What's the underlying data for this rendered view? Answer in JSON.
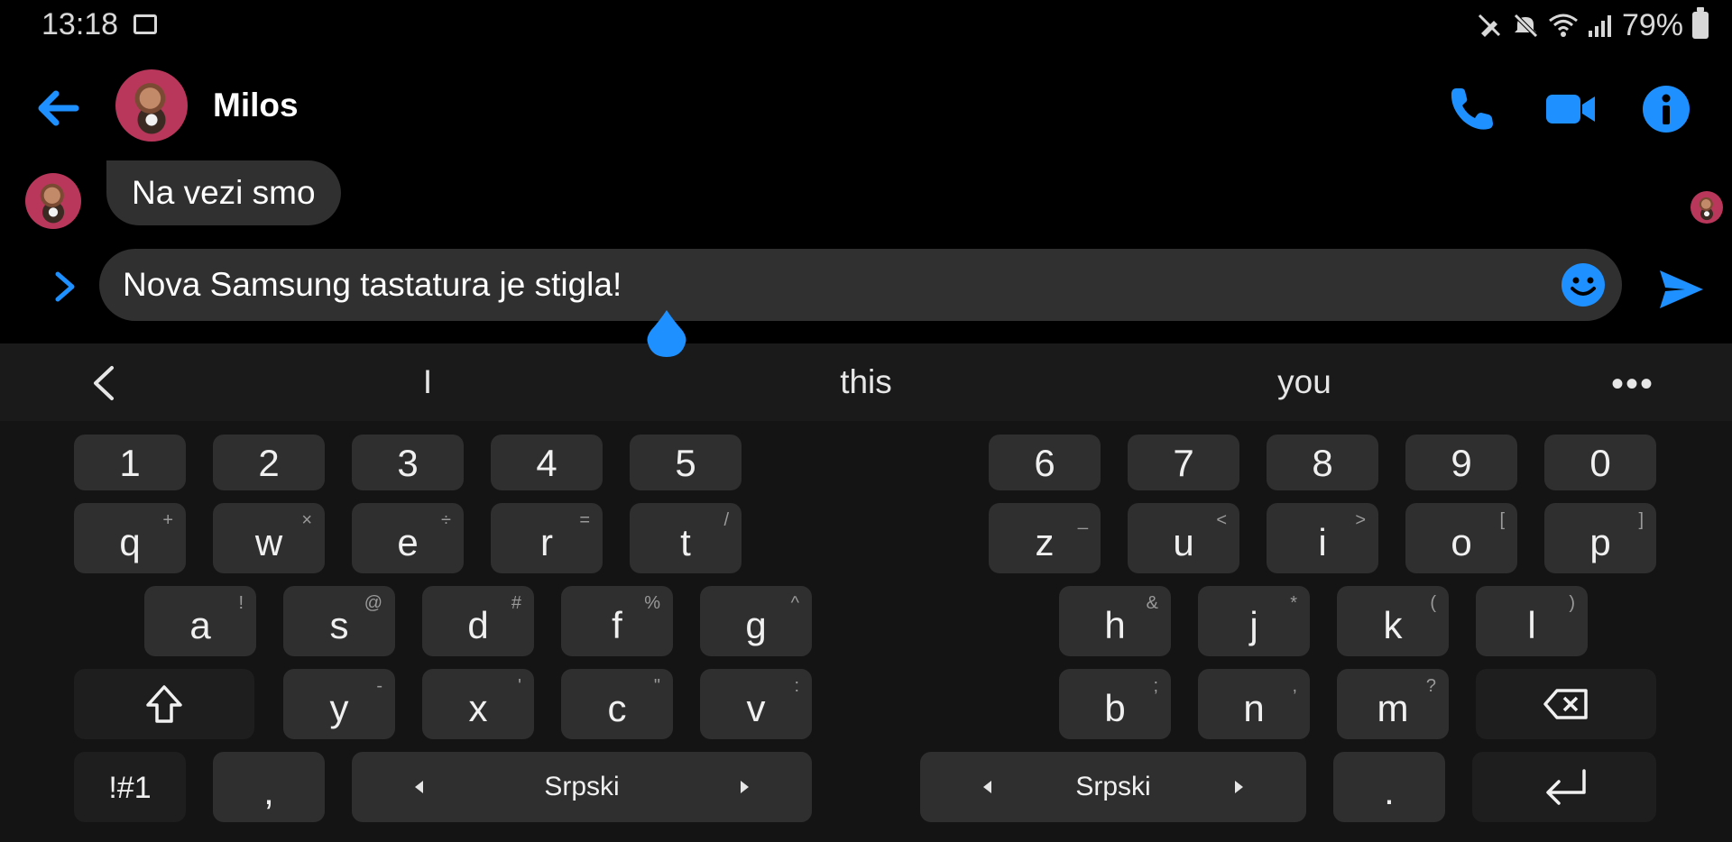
{
  "status_bar": {
    "time": "13:18",
    "battery": "79%"
  },
  "header": {
    "contact_name": "Milos"
  },
  "conversation": {
    "messages": [
      {
        "text": "Na vezi smo"
      }
    ]
  },
  "composer": {
    "text": "Nova Samsung tastatura je stigla!"
  },
  "keyboard": {
    "suggestions": [
      "I",
      "this",
      "you"
    ],
    "number_row": [
      "1",
      "2",
      "3",
      "4",
      "5",
      "6",
      "7",
      "8",
      "9",
      "0"
    ],
    "row1": [
      {
        "key": "q",
        "hint": "+"
      },
      {
        "key": "w",
        "hint": "×"
      },
      {
        "key": "e",
        "hint": "÷"
      },
      {
        "key": "r",
        "hint": "="
      },
      {
        "key": "t",
        "hint": "/"
      },
      {
        "key": "z",
        "hint": "_"
      },
      {
        "key": "u",
        "hint": "<"
      },
      {
        "key": "i",
        "hint": ">"
      },
      {
        "key": "o",
        "hint": "["
      },
      {
        "key": "p",
        "hint": "]"
      }
    ],
    "row2": [
      {
        "key": "a",
        "hint": "!"
      },
      {
        "key": "s",
        "hint": "@"
      },
      {
        "key": "d",
        "hint": "#"
      },
      {
        "key": "f",
        "hint": "%"
      },
      {
        "key": "g",
        "hint": "^"
      },
      {
        "key": "h",
        "hint": "&"
      },
      {
        "key": "j",
        "hint": "*"
      },
      {
        "key": "k",
        "hint": "("
      },
      {
        "key": "l",
        "hint": ")"
      }
    ],
    "row3": [
      {
        "key": "y",
        "hint": "-"
      },
      {
        "key": "x",
        "hint": "'"
      },
      {
        "key": "c",
        "hint": "\""
      },
      {
        "key": "v",
        "hint": ":"
      },
      {
        "key": "b",
        "hint": ";"
      },
      {
        "key": "n",
        "hint": ","
      },
      {
        "key": "m",
        "hint": "?"
      }
    ],
    "symbols_label": "!#1",
    "comma": ",",
    "period": ".",
    "language_label": "Srpski"
  },
  "colors": {
    "accent": "#1e90ff",
    "background": "#000000",
    "bubble": "#303030",
    "key": "#2f2f2f"
  }
}
